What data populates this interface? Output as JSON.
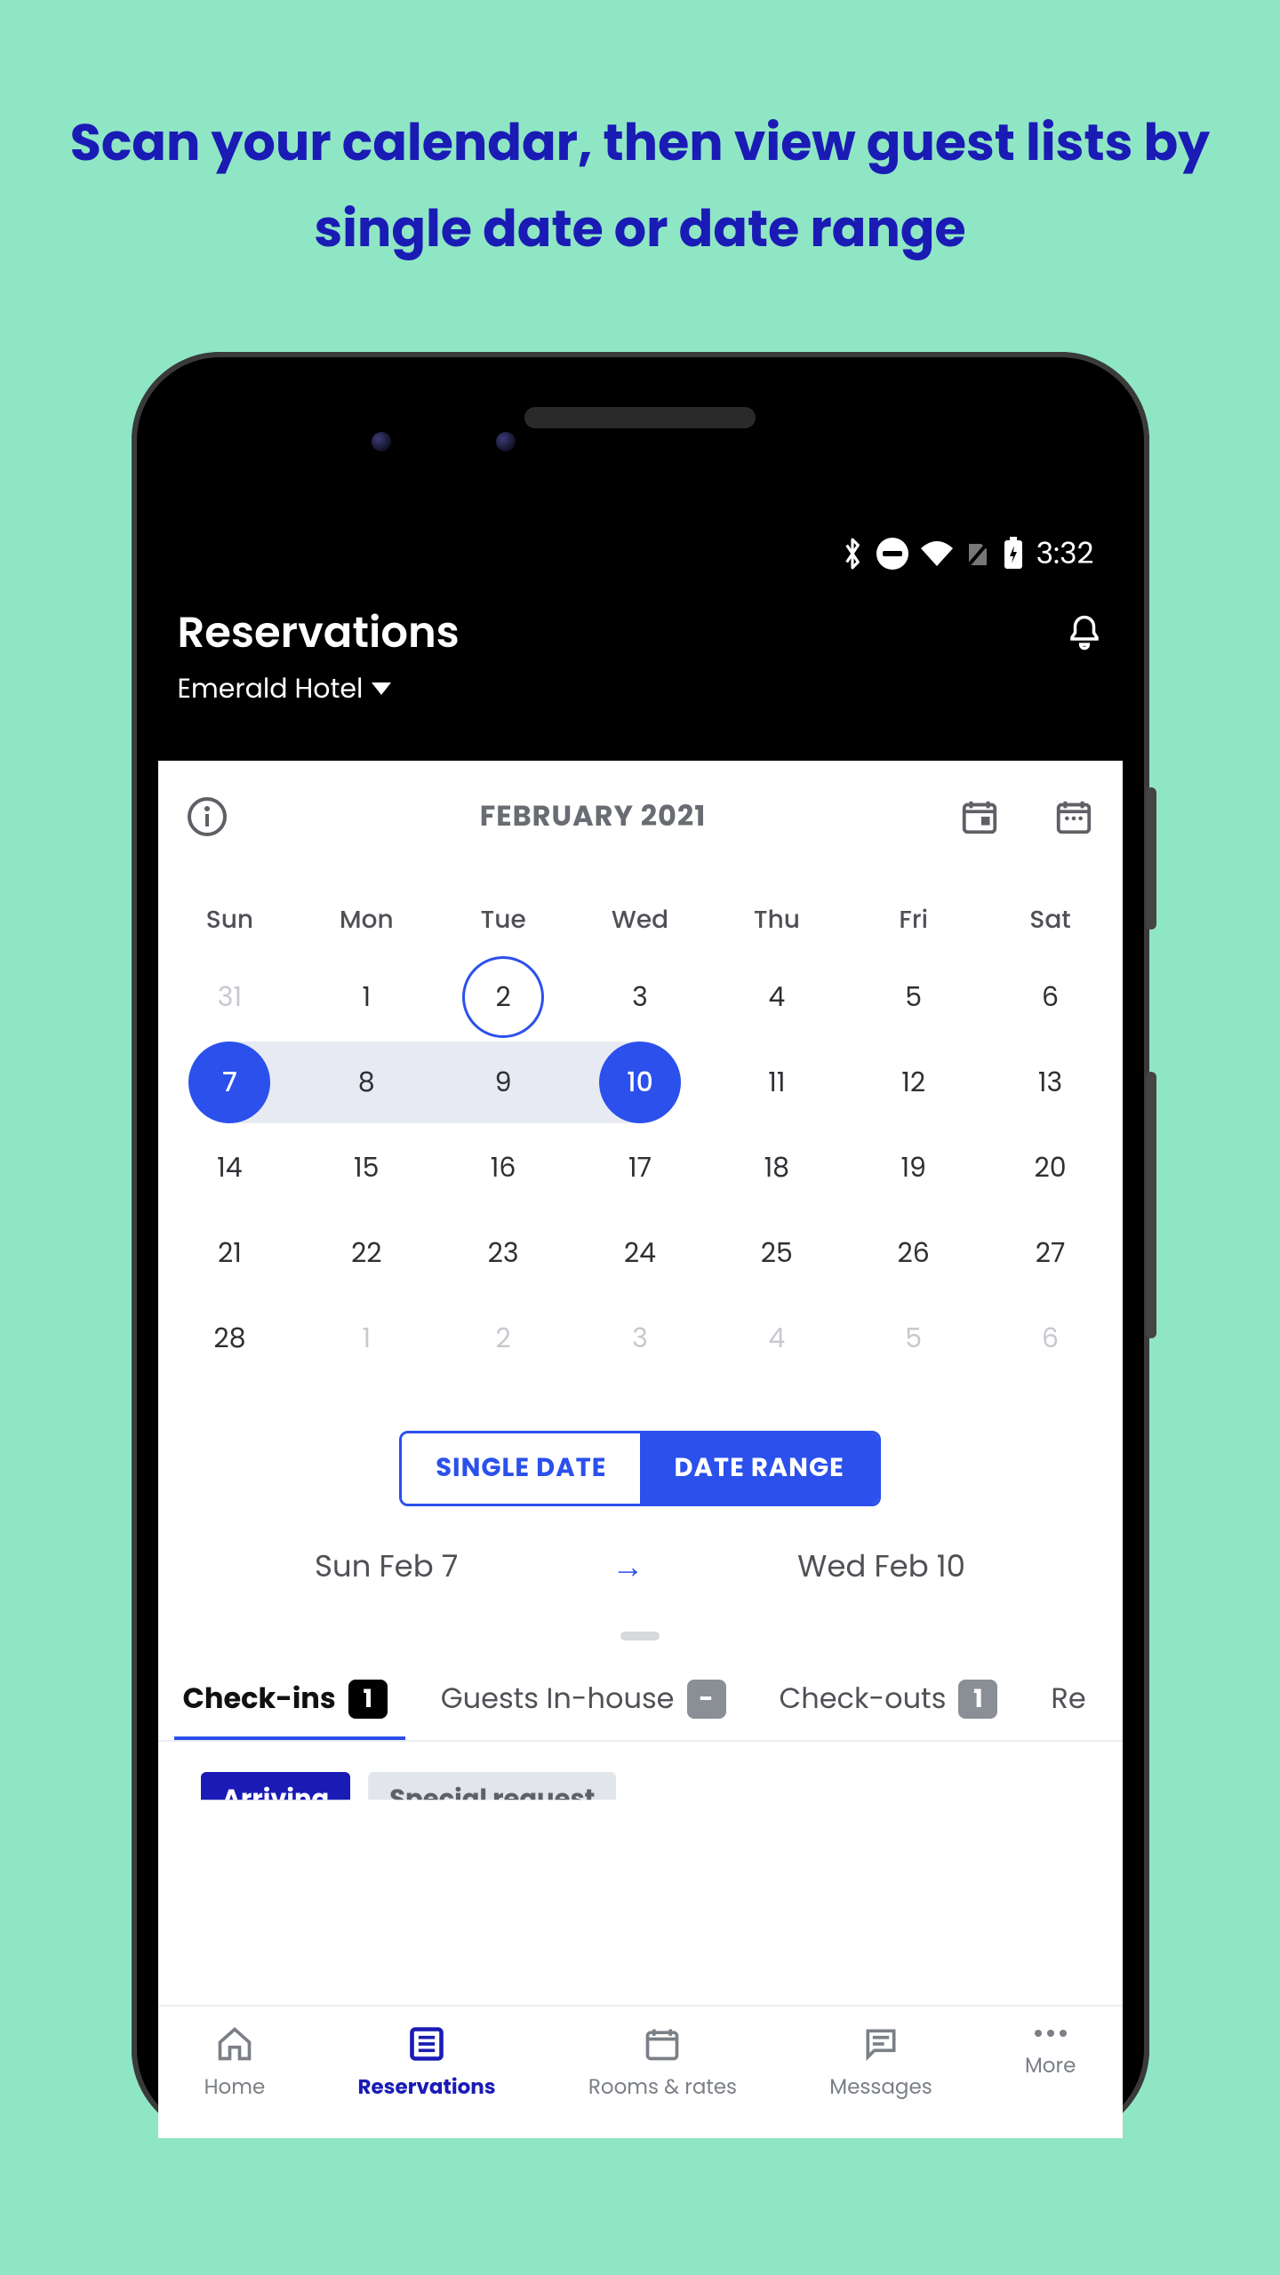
{
  "marketing_headline": "Scan your calendar, then view guest lists by single date or date range",
  "status_bar": {
    "time": "3:32"
  },
  "header": {
    "title": "Reservations",
    "hotel": "Emerald Hotel"
  },
  "calendar": {
    "month_label": "FEBRUARY 2021",
    "day_of_week": [
      "Sun",
      "Mon",
      "Tue",
      "Wed",
      "Thu",
      "Fri",
      "Sat"
    ],
    "weeks": [
      [
        {
          "n": "31",
          "out": true
        },
        {
          "n": "1"
        },
        {
          "n": "2",
          "today": true
        },
        {
          "n": "3"
        },
        {
          "n": "4"
        },
        {
          "n": "5"
        },
        {
          "n": "6"
        }
      ],
      [
        {
          "n": "7",
          "sel_start": true
        },
        {
          "n": "8",
          "in_range": true
        },
        {
          "n": "9",
          "in_range": true
        },
        {
          "n": "10",
          "sel_end": true
        },
        {
          "n": "11"
        },
        {
          "n": "12"
        },
        {
          "n": "13"
        }
      ],
      [
        {
          "n": "14"
        },
        {
          "n": "15"
        },
        {
          "n": "16"
        },
        {
          "n": "17"
        },
        {
          "n": "18"
        },
        {
          "n": "19"
        },
        {
          "n": "20"
        }
      ],
      [
        {
          "n": "21"
        },
        {
          "n": "22"
        },
        {
          "n": "23"
        },
        {
          "n": "24"
        },
        {
          "n": "25"
        },
        {
          "n": "26"
        },
        {
          "n": "27"
        }
      ],
      [
        {
          "n": "28"
        },
        {
          "n": "1",
          "out": true
        },
        {
          "n": "2",
          "out": true
        },
        {
          "n": "3",
          "out": true
        },
        {
          "n": "4",
          "out": true
        },
        {
          "n": "5",
          "out": true
        },
        {
          "n": "6",
          "out": true
        }
      ]
    ]
  },
  "toggle": {
    "single_label": "SINGLE DATE",
    "range_label": "DATE RANGE",
    "active": "range"
  },
  "selected_range": {
    "start": "Sun Feb 7",
    "end": "Wed Feb 10"
  },
  "tabs": [
    {
      "label": "Check-ins",
      "badge": "1",
      "badge_style": "black",
      "active": true
    },
    {
      "label": "Guests In-house",
      "badge": "-",
      "badge_style": "grey"
    },
    {
      "label": "Check-outs",
      "badge": "1",
      "badge_style": "grey"
    },
    {
      "label": "Re",
      "partial": true
    }
  ],
  "chips": [
    {
      "label": "Arriving",
      "style": "primary"
    },
    {
      "label": "Special request",
      "style": "secondary"
    }
  ],
  "bottom_nav": [
    {
      "label": "Home",
      "icon": "home"
    },
    {
      "label": "Reservations",
      "icon": "list",
      "active": true
    },
    {
      "label": "Rooms & rates",
      "icon": "calendar"
    },
    {
      "label": "Messages",
      "icon": "chat"
    },
    {
      "label": "More",
      "icon": "more"
    }
  ],
  "colors": {
    "accent": "#2b50ec",
    "brand_dark": "#1a1bb5"
  }
}
